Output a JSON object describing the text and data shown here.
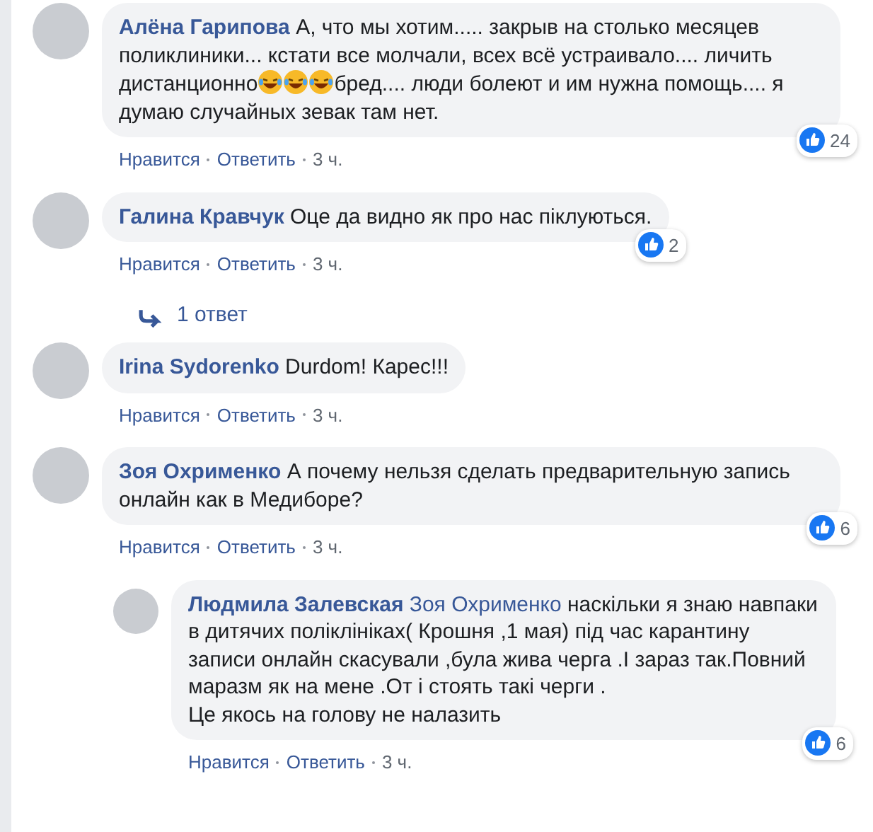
{
  "comments": [
    {
      "author": "Алёна Гарипова",
      "body": [
        {
          "kind": "text",
          "text": "А, что мы хотим..... закрыв на столько месяцев поликлиники... кстати все молчали, всех всё устраивало.... личить дистанционно"
        },
        {
          "kind": "emoji"
        },
        {
          "kind": "emoji"
        },
        {
          "kind": "emoji"
        },
        {
          "kind": "text",
          "text": "бред.... люди болеют и им нужна помощь.... я думаю случайных зевак там нет."
        }
      ],
      "likes": "24",
      "actions": [
        "Нравится",
        "Ответить"
      ],
      "time": "3 ч."
    },
    {
      "author": "Галина Кравчук",
      "body": [
        {
          "kind": "text",
          "text": "Оце да видно як про нас піклуються."
        }
      ],
      "likes": "2",
      "actions": [
        "Нравится",
        "Ответить"
      ],
      "time": "3 ч.",
      "replies_link": "1 ответ"
    },
    {
      "author": "Irina Sydorenko",
      "body": [
        {
          "kind": "text",
          "text": "Durdom! Карес!!!"
        }
      ],
      "actions": [
        "Нравится",
        "Ответить"
      ],
      "time": "3 ч."
    },
    {
      "author": "Зоя Охрименко",
      "body": [
        {
          "kind": "text",
          "text": "А почему нельзя сделать предварительную запись онлайн как в Медиборе?"
        }
      ],
      "likes": "6",
      "actions": [
        "Нравится",
        "Ответить"
      ],
      "time": "3 ч.",
      "replies": [
        {
          "author": "Людмила Залевская",
          "mention": "Зоя Охрименко",
          "body": [
            {
              "kind": "text",
              "text": "наскільки я знаю навпаки в дитячих поліклініках( Крошня ,1 мая) під час карантину записи онлайн скасували ,була жива черга .І зараз так.Повний маразм як на мене .От і стоять такі черги .\nЦе якось на голову не налазить"
            }
          ],
          "likes": "6",
          "actions": [
            "Нравится",
            "Ответить"
          ],
          "time": "3 ч."
        }
      ]
    }
  ]
}
